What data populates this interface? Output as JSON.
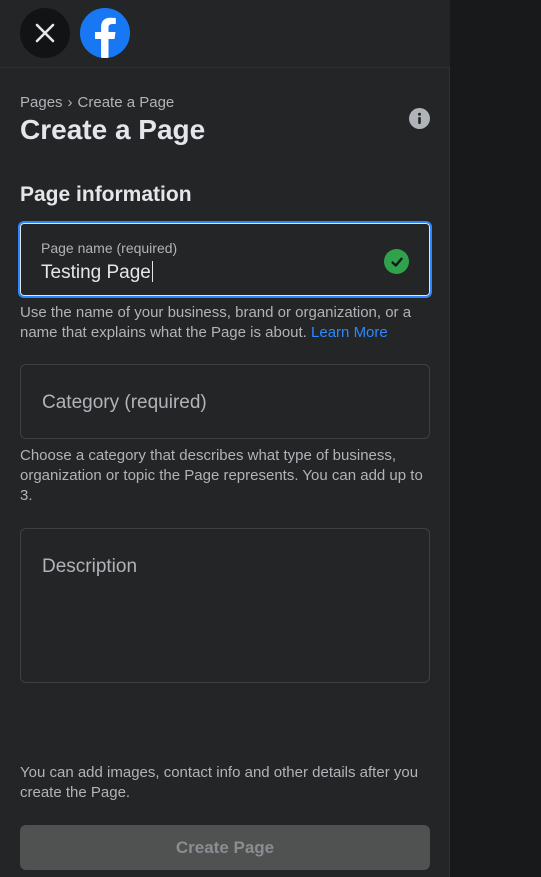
{
  "header": {
    "close_icon": "close-icon",
    "logo": "facebook-logo"
  },
  "breadcrumb": {
    "parent": "Pages",
    "separator": "›",
    "current": "Create a Page"
  },
  "page_title": "Create a Page",
  "info_icon": "info-icon",
  "section_title": "Page information",
  "page_name": {
    "label": "Page name (required)",
    "value": "Testing Page",
    "status_icon": "check-icon",
    "help": "Use the name of your business, brand or organization, or a name that explains what the Page is about.",
    "learn_more": "Learn More"
  },
  "category": {
    "placeholder": "Category (required)",
    "help": "Choose a category that describes what type of business, organization or topic the Page represents. You can add up to 3."
  },
  "description": {
    "placeholder": "Description"
  },
  "footer_note": "You can add images, contact info and other details after you create the Page.",
  "create_button": "Create Page",
  "colors": {
    "panel_bg": "#242526",
    "page_bg": "#18191a",
    "accent": "#2d88ff",
    "brand": "#1877f2",
    "success": "#31a24c",
    "disabled_button": "#505151"
  }
}
